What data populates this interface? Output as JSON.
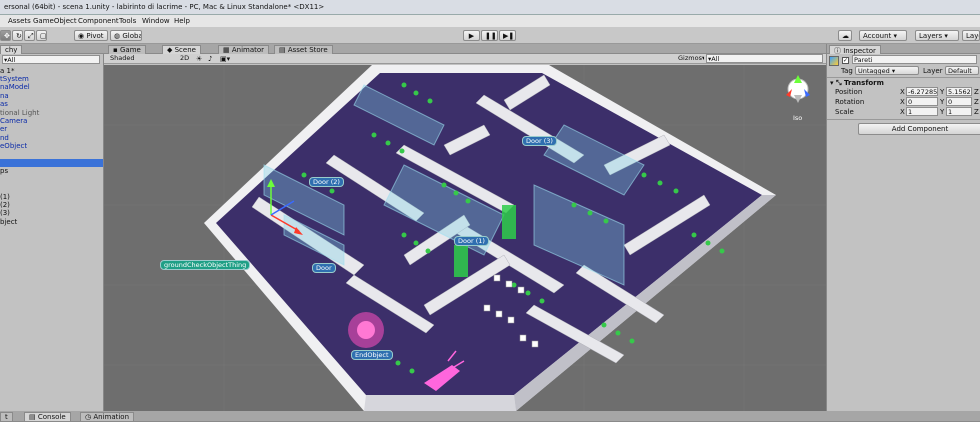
{
  "window": {
    "title": "ersonal (64bit) - scena 1.unity - labirinto di lacrime - PC, Mac & Linux Standalone* <DX11>"
  },
  "menu": [
    "Assets",
    "GameObject",
    "Component",
    "Tools",
    "Window",
    "Help"
  ],
  "toolbar": {
    "pivot": "Pivot",
    "global": "Global",
    "account": "Account",
    "layers": "Layers",
    "layout": "Layo"
  },
  "center_tabs": [
    "Game",
    "Scene",
    "Animator",
    "Asset Store"
  ],
  "hierarchy": {
    "tab": "chy",
    "search": "All",
    "scene": "a 1*",
    "items": [
      {
        "label": "tSystem",
        "color": "blue"
      },
      {
        "label": "naModel",
        "color": "blue"
      },
      {
        "label": "na",
        "color": "blue"
      },
      {
        "label": "as",
        "color": "blue"
      },
      {
        "label": "tional Light",
        "color": "gray"
      },
      {
        "label": "Camera",
        "color": "blue"
      },
      {
        "label": "er",
        "color": "blue"
      },
      {
        "label": "nd",
        "color": "blue"
      },
      {
        "label": "eObject",
        "color": "blue"
      },
      {
        "label": "",
        "color": "blue"
      },
      {
        "label": "",
        "color": "selected"
      },
      {
        "label": "ps",
        "color": "black"
      },
      {
        "label": "",
        "color": "black"
      },
      {
        "label": "",
        "color": "black"
      },
      {
        "label": "(1)",
        "color": "black"
      },
      {
        "label": "(2)",
        "color": "black"
      },
      {
        "label": "(3)",
        "color": "black"
      },
      {
        "label": "bject",
        "color": "black"
      }
    ]
  },
  "scene": {
    "shading": "Shaded",
    "mode": "2D",
    "gizmos": "Gizmos",
    "search": "All",
    "projection": "Iso",
    "labels": [
      "Door (3)",
      "Door (2)",
      "Door (1)",
      "Door",
      "groundCheckObjectThing",
      "EndObject"
    ]
  },
  "inspector": {
    "tab": "Inspector",
    "object_name": "Pareti",
    "tag_label": "Tag",
    "tag_value": "Untagged",
    "layer_label": "Layer",
    "layer_value": "Default",
    "transform": "Transform",
    "position": {
      "label": "Position",
      "x": "-6.27285",
      "y": "5.15625",
      "z": ""
    },
    "rotation": {
      "label": "Rotation",
      "x": "0",
      "y": "0",
      "z": ""
    },
    "scale": {
      "label": "Scale",
      "x": "1",
      "y": "1",
      "z": ""
    },
    "add_component": "Add Component"
  },
  "bottom_tabs": [
    "t",
    "Console",
    "Animation"
  ]
}
